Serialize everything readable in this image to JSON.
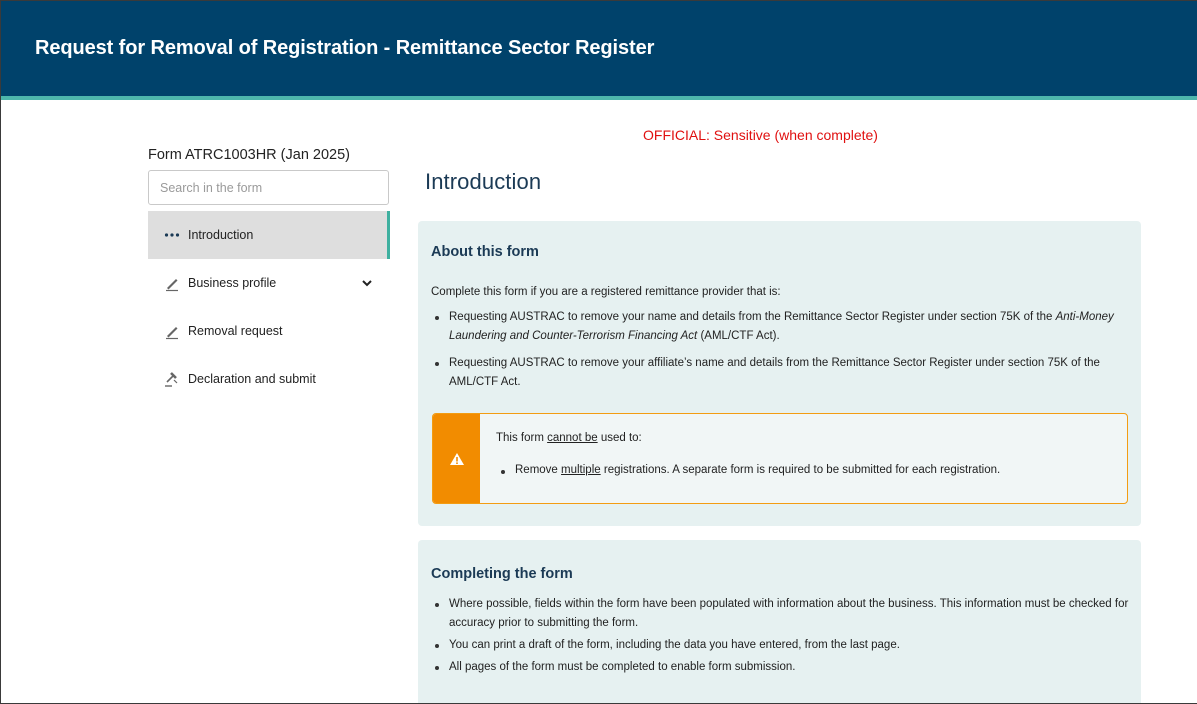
{
  "header": {
    "title": "Request for Removal of Registration - Remittance Sector Register",
    "background_color": "#00426b",
    "accent_color": "#4db6ac"
  },
  "sidebar": {
    "form_code": "Form ATRC1003HR (Jan 2025)",
    "search_placeholder": "Search in the form",
    "items": [
      {
        "label": "Introduction",
        "icon": "dots-icon",
        "active": true
      },
      {
        "label": "Business profile",
        "icon": "pencil-icon",
        "expandable": true
      },
      {
        "label": "Removal request",
        "icon": "pencil-icon"
      },
      {
        "label": "Declaration and submit",
        "icon": "gavel-icon"
      }
    ]
  },
  "classification": "OFFICIAL: Sensitive (when complete)",
  "page_title": "Introduction",
  "about": {
    "heading": "About this form",
    "intro": "Complete this form if you are a registered remittance provider that is:",
    "bullet1": {
      "a": "Requesting AUSTRAC to remove your name and details from the Remittance Sector Register under section 75K of the ",
      "italic": "Anti-Money Laundering and Counter-Terrorism Financing Act",
      "b": " (AML/CTF Act)."
    },
    "bullet2": "Requesting AUSTRAC to remove your affiliate’s name and details from the Remittance Sector Register under section 75K of the AML/CTF Act.",
    "warning": {
      "lead_a": "This form ",
      "lead_underline": "cannot be",
      "lead_b": " used to:",
      "item_a": "Remove ",
      "item_underline": "multiple",
      "item_b": " registrations. A separate form is required to be submitted for each registration.",
      "color": "#f28c00"
    }
  },
  "completing": {
    "heading": "Completing the form",
    "bullets": [
      "Where possible, fields within the form have been populated with information about the business. This information must be checked for accuracy prior to submitting the form.",
      "You can print a draft of the form, including the data you have entered, from the last page.",
      "All pages of the form must be completed to enable form submission."
    ]
  }
}
